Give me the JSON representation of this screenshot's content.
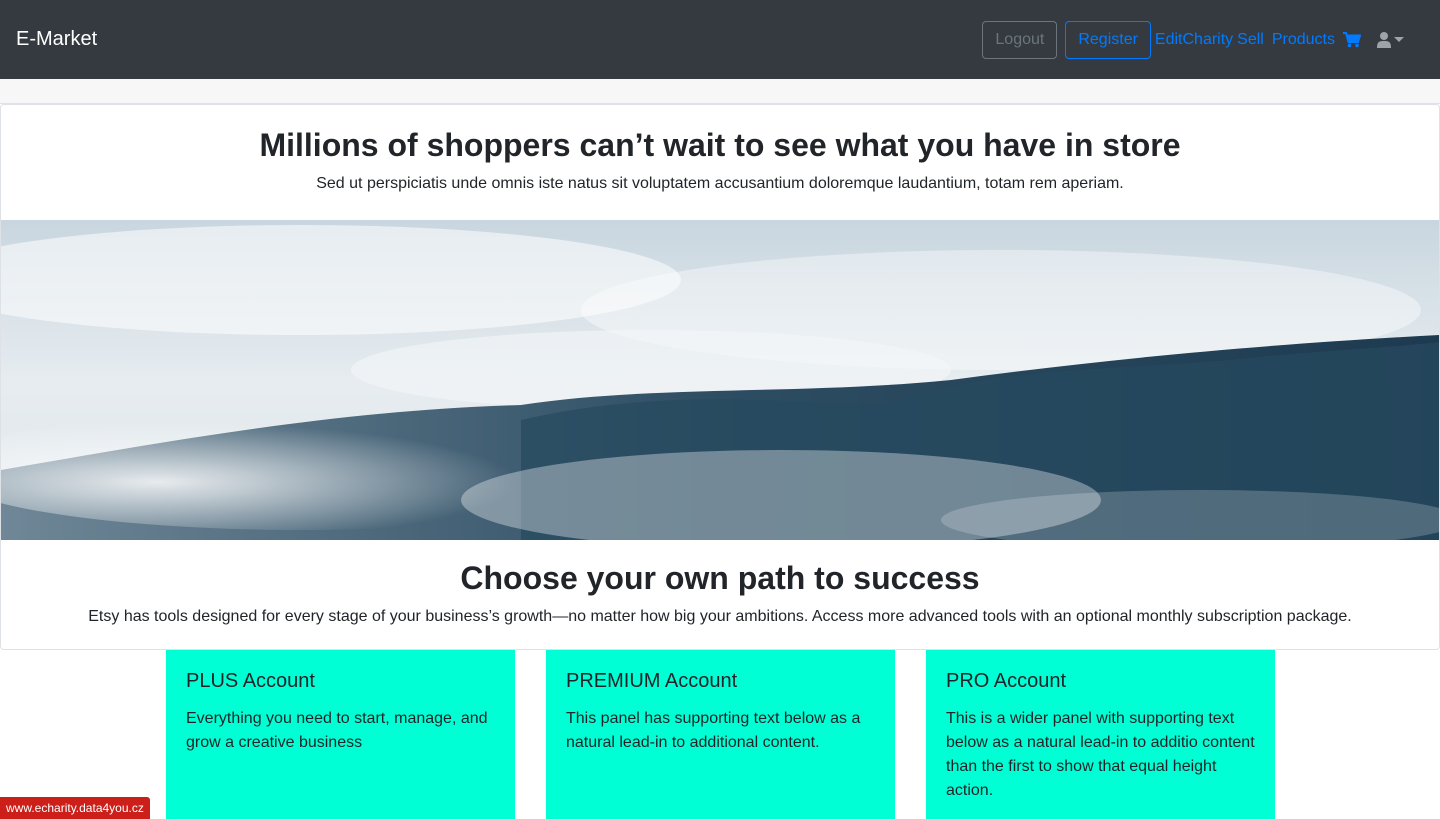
{
  "navbar": {
    "brand": "E-Market",
    "logout_label": "Logout",
    "register_label": "Register",
    "edit_charity_label": "EditCharity",
    "sell_label": "Sell",
    "products_label": "Products",
    "cart_icon": "cart-icon",
    "user_icon": "user-icon"
  },
  "hero": {
    "headline": "Millions of shoppers can’t wait to see what you have in store",
    "subtext": "Sed ut perspiciatis unde omnis iste natus sit voluptatem accusantium doloremque laudantium, totam rem aperiam.",
    "image_alt": "foggy-forest-image"
  },
  "path": {
    "headline": "Choose your own path to success",
    "subtext": "Etsy has tools designed for every stage of your business’s growth—no matter how big your ambitions. Access more advanced tools with an optional monthly subscription package."
  },
  "cards": [
    {
      "title": "PLUS Account",
      "text": "Everything you need to start, manage, and grow a creative business"
    },
    {
      "title": "PREMIUM Account",
      "text": "This panel has supporting text below as a natural lead-in to additional content."
    },
    {
      "title": "PRO Account",
      "text": "This is a wider panel with supporting text below as a natural lead-in to additio content than the first to show that equal height action."
    }
  ],
  "footer_badge": "www.echarity.data4you.cz",
  "colors": {
    "navbar": "#343a40",
    "link": "#007bff",
    "card": "#00ffd4",
    "badge": "#cc1f1a"
  }
}
